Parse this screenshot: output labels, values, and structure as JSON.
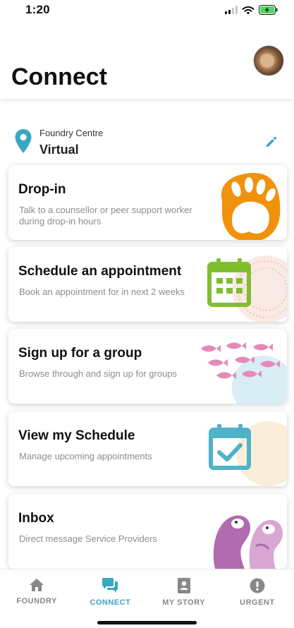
{
  "status_bar": {
    "time": "1:20"
  },
  "header": {
    "title": "Connect"
  },
  "location": {
    "label": "Foundry Centre",
    "value": "Virtual",
    "pin_color": "#3aa6c2",
    "edit_color": "#3aa6c2"
  },
  "cards": [
    {
      "title": "Drop-in",
      "description": "Talk to a counsellor or peer support worker during drop-in hours",
      "icon": "bear-paw-icon",
      "color": "#f0920c"
    },
    {
      "title": "Schedule an appointment",
      "description": "Book an appointment for in next 2 weeks",
      "icon": "calendar-grid-icon",
      "color": "#7fbf2e"
    },
    {
      "title": "Sign up for a group",
      "description": "Browse through and sign up for groups",
      "icon": "fish-school-icon",
      "color": "#e58ab9"
    },
    {
      "title": "View my Schedule",
      "description": "Manage upcoming appointments",
      "icon": "calendar-check-icon",
      "color": "#4fb2c9"
    },
    {
      "title": "Inbox",
      "description": "Direct message Service Providers",
      "icon": "otters-icon",
      "color": "#b06aae"
    }
  ],
  "bottom_nav": [
    {
      "label": "FOUNDRY",
      "icon": "home-icon",
      "active": false
    },
    {
      "label": "CONNECT",
      "icon": "chat-bubbles-icon",
      "active": true
    },
    {
      "label": "MY STORY",
      "icon": "journal-icon",
      "active": false
    },
    {
      "label": "URGENT",
      "icon": "alert-icon",
      "active": false
    }
  ],
  "colors": {
    "accent": "#3aa6c2",
    "inactive_nav": "#888888"
  }
}
